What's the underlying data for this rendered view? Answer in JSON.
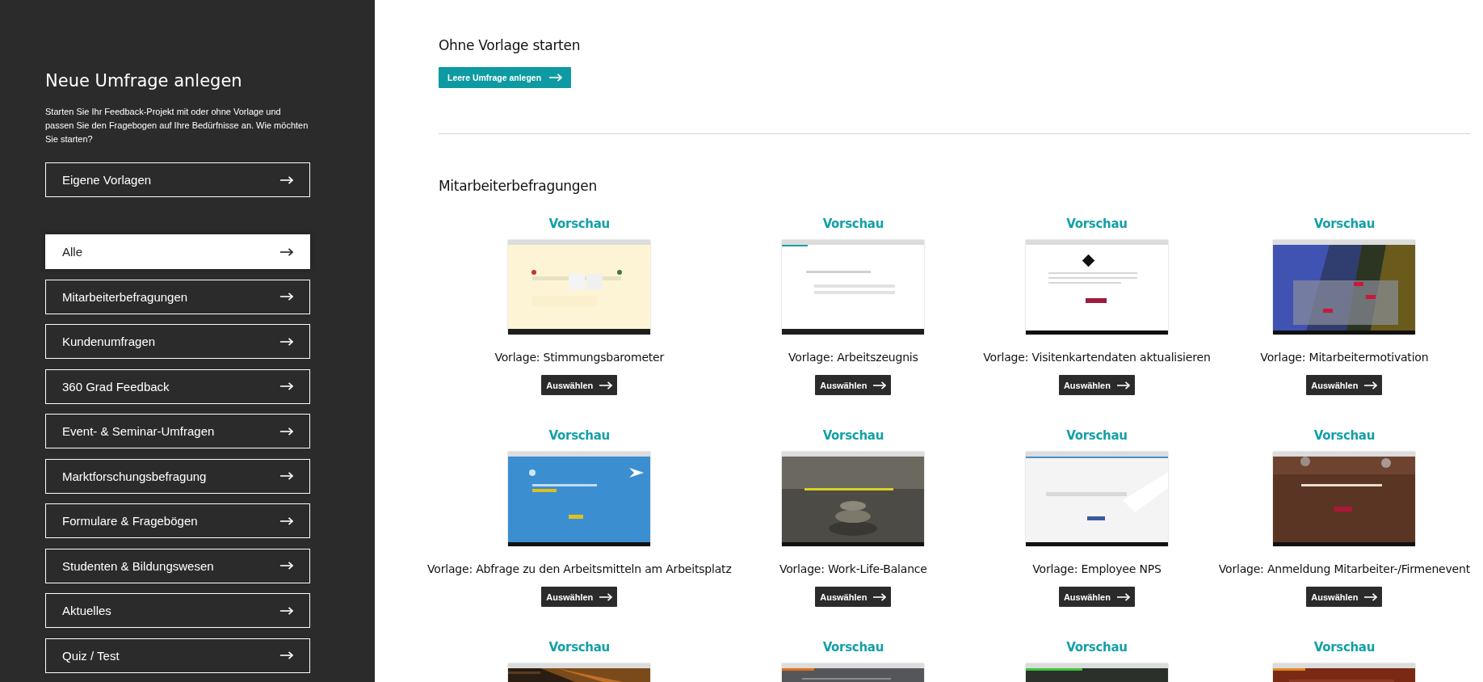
{
  "sidebar": {
    "title": "Neue Umfrage anlegen",
    "intro": "Starten Sie Ihr Feedback-Projekt mit oder ohne Vorlage und passen Sie den Fragebogen auf Ihre Bedürfnisse an. Wie möchten Sie starten?",
    "own_templates": {
      "label": "Eigene Vorlagen"
    },
    "categories": [
      {
        "label": "Alle",
        "selected": true
      },
      {
        "label": "Mitarbeiterbefragungen",
        "selected": false
      },
      {
        "label": "Kundenumfragen",
        "selected": false
      },
      {
        "label": "360 Grad Feedback",
        "selected": false
      },
      {
        "label": "Event- & Seminar-Umfragen",
        "selected": false
      },
      {
        "label": "Marktforschungsbefragung",
        "selected": false
      },
      {
        "label": "Formulare & Fragebögen",
        "selected": false
      },
      {
        "label": "Studenten & Bildungswesen",
        "selected": false
      },
      {
        "label": "Aktuelles",
        "selected": false
      },
      {
        "label": "Quiz / Test",
        "selected": false
      }
    ]
  },
  "blank_start": {
    "heading": "Ohne Vorlage starten",
    "button": "Leere Umfrage anlegen"
  },
  "section": {
    "heading": "Mitarbeiterbefragungen",
    "templates": [
      {
        "preview": "Vorschau",
        "title": "Vorlage: Stimmungsbarometer",
        "button": "Auswählen"
      },
      {
        "preview": "Vorschau",
        "title": "Vorlage: Arbeitszeugnis",
        "button": "Auswählen"
      },
      {
        "preview": "Vorschau",
        "title": "Vorlage: Visitenkartendaten aktualisieren",
        "button": "Auswählen"
      },
      {
        "preview": "Vorschau",
        "title": "Vorlage: Mitarbeitermotivation",
        "button": "Auswählen"
      },
      {
        "preview": "Vorschau",
        "title": "Vorlage: Abfrage zu den Arbeitsmitteln am Arbeitsplatz",
        "button": "Auswählen"
      },
      {
        "preview": "Vorschau",
        "title": "Vorlage: Work-Life-Balance",
        "button": "Auswählen"
      },
      {
        "preview": "Vorschau",
        "title": "Vorlage: Employee NPS",
        "button": "Auswählen"
      },
      {
        "preview": "Vorschau",
        "title": "Vorlage: Anmeldung Mitarbeiter-/Firmenevent",
        "button": "Auswählen"
      },
      {
        "preview": "Vorschau"
      },
      {
        "preview": "Vorschau"
      },
      {
        "preview": "Vorschau"
      },
      {
        "preview": "Vorschau"
      }
    ]
  }
}
